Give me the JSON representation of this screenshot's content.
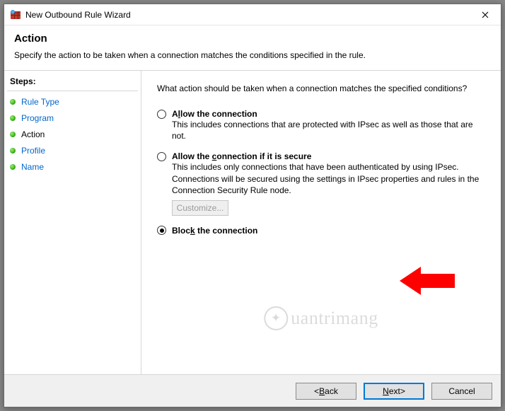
{
  "window": {
    "title": "New Outbound Rule Wizard"
  },
  "header": {
    "title": "Action",
    "subtitle": "Specify the action to be taken when a connection matches the conditions specified in the rule."
  },
  "steps": {
    "header": "Steps:",
    "items": [
      {
        "label": "Rule Type",
        "current": false
      },
      {
        "label": "Program",
        "current": false
      },
      {
        "label": "Action",
        "current": true
      },
      {
        "label": "Profile",
        "current": false
      },
      {
        "label": "Name",
        "current": false
      }
    ]
  },
  "content": {
    "question": "What action should be taken when a connection matches the specified conditions?",
    "options": [
      {
        "id": "allow",
        "label_pre": "A",
        "label_u": "l",
        "label_post": "low the connection",
        "desc": "This includes connections that are protected with IPsec as well as those that are not.",
        "checked": false
      },
      {
        "id": "allow-secure",
        "label_pre": "Allow the ",
        "label_u": "c",
        "label_post": "onnection if it is secure",
        "desc": "This includes only connections that have been authenticated by using IPsec. Connections will be secured using the settings in IPsec properties and rules in the Connection Security Rule node.",
        "checked": false,
        "customize_label": "Customize..."
      },
      {
        "id": "block",
        "label_pre": "Bloc",
        "label_u": "k",
        "label_post": " the connection",
        "desc": "",
        "checked": true
      }
    ]
  },
  "footer": {
    "back": "Back",
    "next": "Next",
    "cancel": "Cancel"
  },
  "watermark": "uantrimang"
}
